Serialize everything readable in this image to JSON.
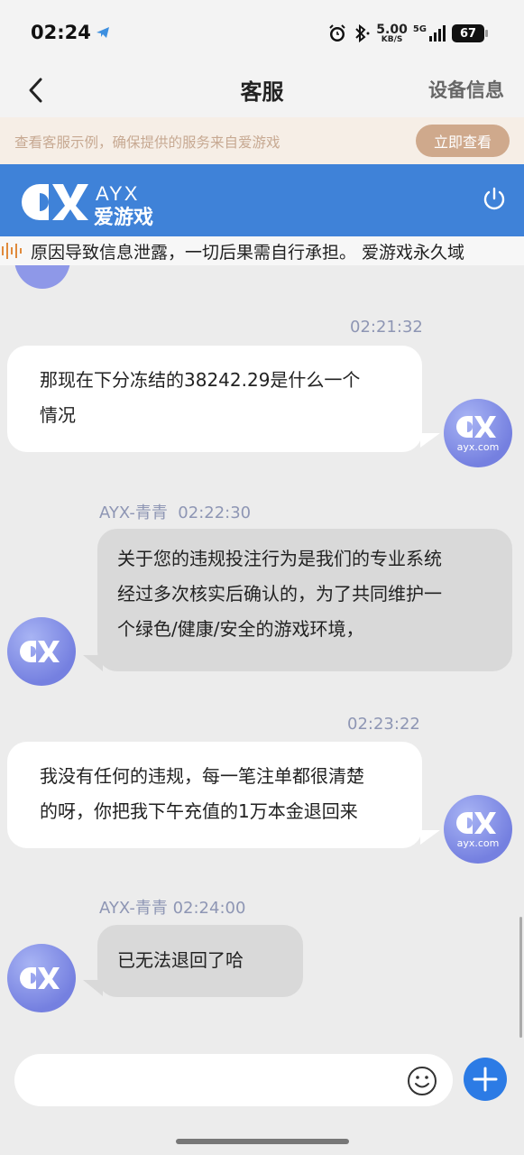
{
  "status_bar": {
    "time": "02:24",
    "net_speed": "5.00",
    "net_unit": "KB/S",
    "network": "5G",
    "battery": "67"
  },
  "nav": {
    "title": "客服",
    "device_info": "设备信息"
  },
  "notice": {
    "text": "查看客服示例，确保提供的服务来自爱游戏",
    "button": "立即查看"
  },
  "brand": {
    "logo_text_en": "AYX",
    "logo_text_cn": "爱游戏"
  },
  "marquee": {
    "text": "原因导致信息泄露，一切后果需自行承担。 爱游戏永久域"
  },
  "messages": [
    {
      "side": "mine",
      "time": "02:21:32",
      "lines": [
        "那现在下分冻结的38242.29是什么一个",
        "情况"
      ]
    },
    {
      "side": "theirs",
      "sender": "AYX-青青",
      "time": "02:22:30",
      "lines": [
        "关于您的违规投注行为是我们的专业系统",
        "经过多次核实后确认的，为了共同维护一",
        "个绿色/健康/安全的游戏环境，"
      ]
    },
    {
      "side": "mine",
      "time": "02:23:22",
      "lines": [
        "我没有任何的违规，每一笔注单都很清楚",
        "的呀，你把我下午充值的1万本金退回来"
      ]
    },
    {
      "side": "theirs",
      "sender": "AYX-青青",
      "time": "02:24:00",
      "lines": [
        "已无法退回了哈"
      ]
    }
  ],
  "avatar": {
    "user_label": "ayx.com"
  },
  "input": {
    "placeholder": ""
  },
  "colors": {
    "brand_blue": "#3f82d8",
    "notice_bg": "#f6eee6",
    "notice_button": "#cfa98c",
    "send_plus": "#2c7be5"
  }
}
